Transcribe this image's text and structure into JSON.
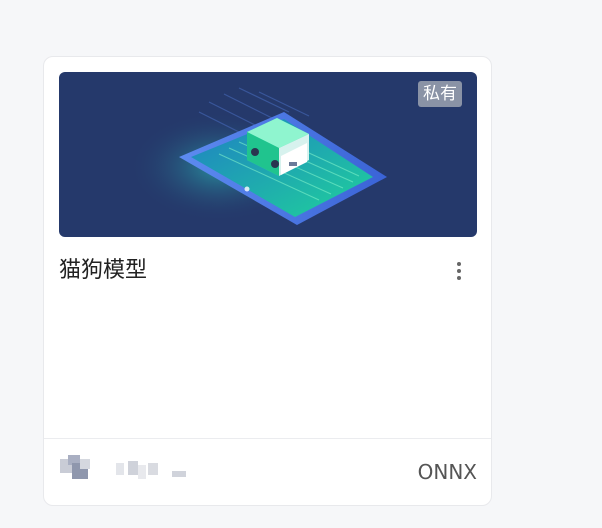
{
  "card": {
    "title": "猫狗模型",
    "badge": "私有",
    "framework": "ONNX",
    "more_icon": "more-vertical-icon",
    "owner_avatar": "blurred-avatar",
    "colors": {
      "cover_bg": "#25396b",
      "badge_bg": "#8a93a6",
      "title": "#222222",
      "framework": "#555555"
    }
  }
}
